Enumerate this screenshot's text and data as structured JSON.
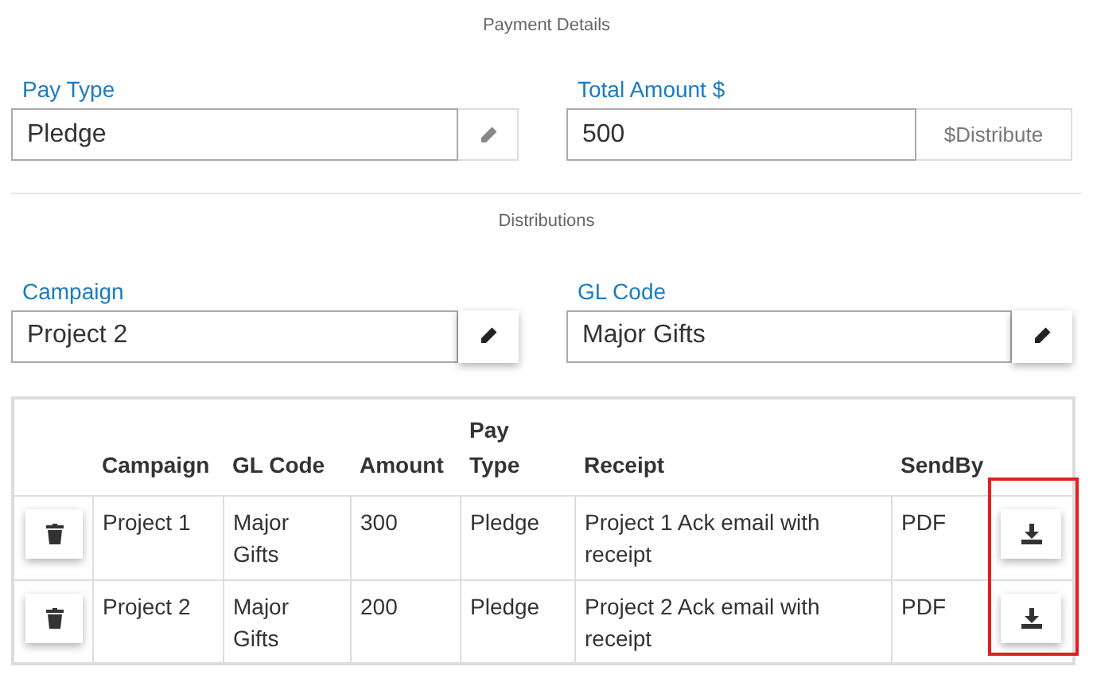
{
  "payment_details": {
    "title": "Payment Details",
    "pay_type": {
      "label": "Pay Type",
      "value": "Pledge"
    },
    "total_amount": {
      "label": "Total Amount $",
      "value": "500",
      "addon": "$Distribute"
    }
  },
  "distributions": {
    "title": "Distributions",
    "campaign": {
      "label": "Campaign",
      "value": "Project 2"
    },
    "gl_code": {
      "label": "GL Code",
      "value": "Major Gifts"
    },
    "table": {
      "columns": [
        "Campaign",
        "GL Code",
        "Amount",
        "Pay Type",
        "Receipt",
        "SendBy"
      ],
      "rows": [
        {
          "cells": [
            "Project 1",
            "Major Gifts",
            "300",
            "Pledge",
            "Project 1 Ack email with receipt",
            "PDF"
          ]
        },
        {
          "cells": [
            "Project 2",
            "Major Gifts",
            "200",
            "Pledge",
            "Project 2 Ack email with receipt",
            "PDF"
          ]
        }
      ]
    },
    "highlight": {
      "on": true
    }
  }
}
